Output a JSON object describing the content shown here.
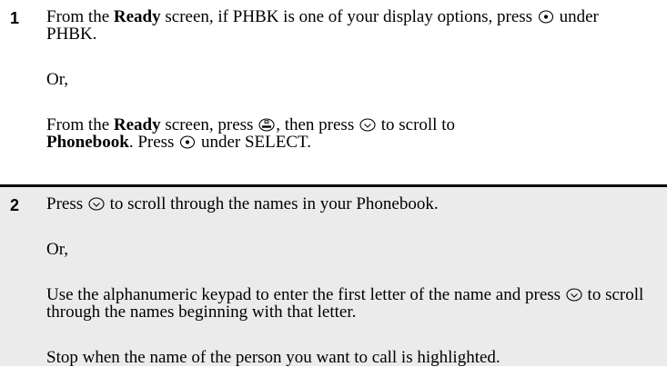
{
  "step1": {
    "number": "1",
    "p1": {
      "a": "From the ",
      "b": "Ready",
      "c": " screen, if PHBK is one of your display options, press ",
      "d": " under PHBK."
    },
    "or": "Or,",
    "p2": {
      "a": "From the ",
      "b": "Ready",
      "c": " screen, press ",
      "d": ", then press ",
      "e": " to scroll to ",
      "f": "Phonebook",
      "g": ". Press ",
      "h": " under SELECT."
    }
  },
  "step2": {
    "number": "2",
    "p1": {
      "a": "Press ",
      "b": " to scroll through the names in your Phonebook."
    },
    "or": "Or,",
    "p2": {
      "a": "Use the alphanumeric keypad to enter the first letter of the name and press ",
      "b": " to scroll through the names beginning with that letter."
    },
    "p3": "Stop when the name of the person you want to call is highlighted."
  },
  "icons": {
    "select_key": "softkey-dot-icon",
    "menu_key": "menu-key-icon",
    "nav_key": "nav-key-icon"
  }
}
